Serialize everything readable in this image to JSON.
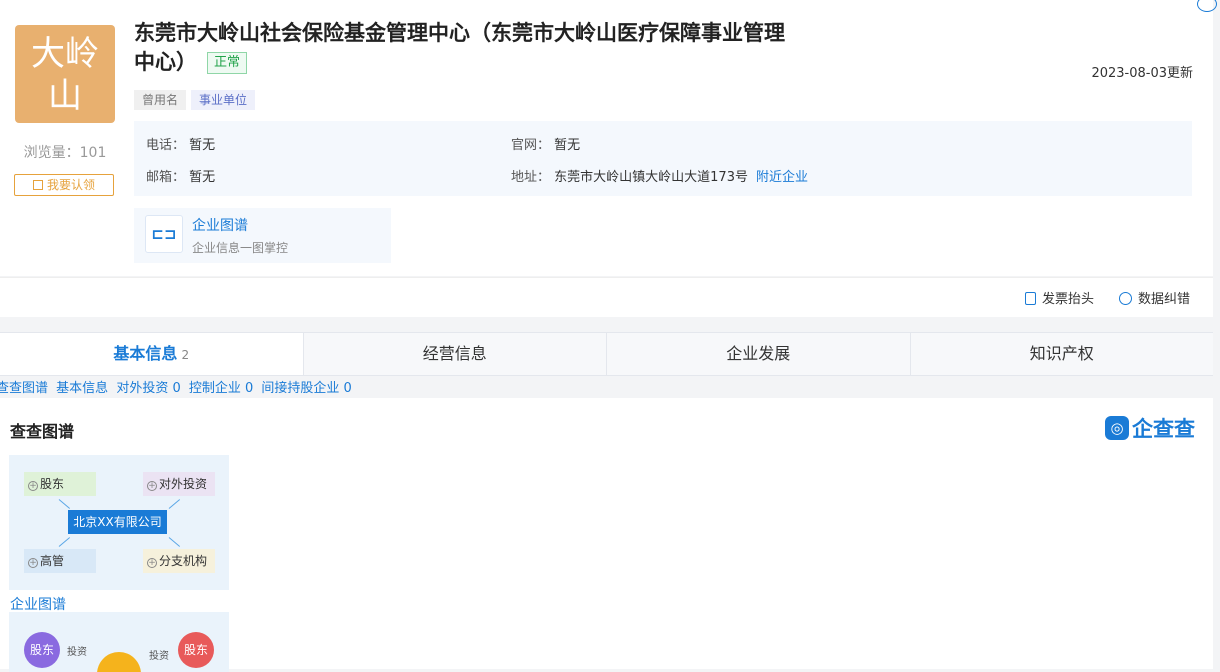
{
  "company": {
    "logo_text": "大岭山",
    "name": "东莞市大岭山社会保险基金管理中心（东莞市大岭山医疗保障事业管理中心）",
    "status": "正常",
    "updated": "2023-08-03更新",
    "tags": [
      "曾用名",
      "事业单位"
    ],
    "views": "浏览量：101",
    "claim_label": "我要认领"
  },
  "contact": {
    "phone_label": "电话：",
    "phone_value": "暂无",
    "website_label": "官网：",
    "website_value": "暂无",
    "email_label": "邮箱：",
    "email_value": "暂无",
    "address_label": "地址：",
    "address_value": "东莞市大岭山镇大岭山大道173号",
    "nearby_link": "附近企业"
  },
  "graph_card": {
    "icon": "graph-icon",
    "title": "企业图谱",
    "subtitle": "企业信息一图掌控"
  },
  "actions": {
    "invoice": "发票抬头",
    "correction": "数据纠错"
  },
  "tabs": [
    {
      "label": "基本信息",
      "count": "2"
    },
    {
      "label": "经营信息",
      "count": ""
    },
    {
      "label": "企业发展",
      "count": ""
    },
    {
      "label": "知识产权",
      "count": ""
    }
  ],
  "sublinks": [
    "查查图谱",
    "基本信息",
    "对外投资 0",
    "控制企业 0",
    "间接持股企业 0"
  ],
  "panel": {
    "title": "查查图谱",
    "brand": "企查查",
    "chart1": {
      "center": "北京XX有限公司",
      "shareholder": "股东",
      "investment": "对外投资",
      "executive": "高管",
      "branch": "分支机构",
      "caption": "企业图谱"
    },
    "chart2": {
      "left": "股东",
      "right": "股东",
      "edge1": "投资",
      "edge2": "投资"
    }
  },
  "colors": {
    "accent": "#1a7bd6",
    "logo_bg": "#e8b06f",
    "status_green": "#22a34a"
  }
}
